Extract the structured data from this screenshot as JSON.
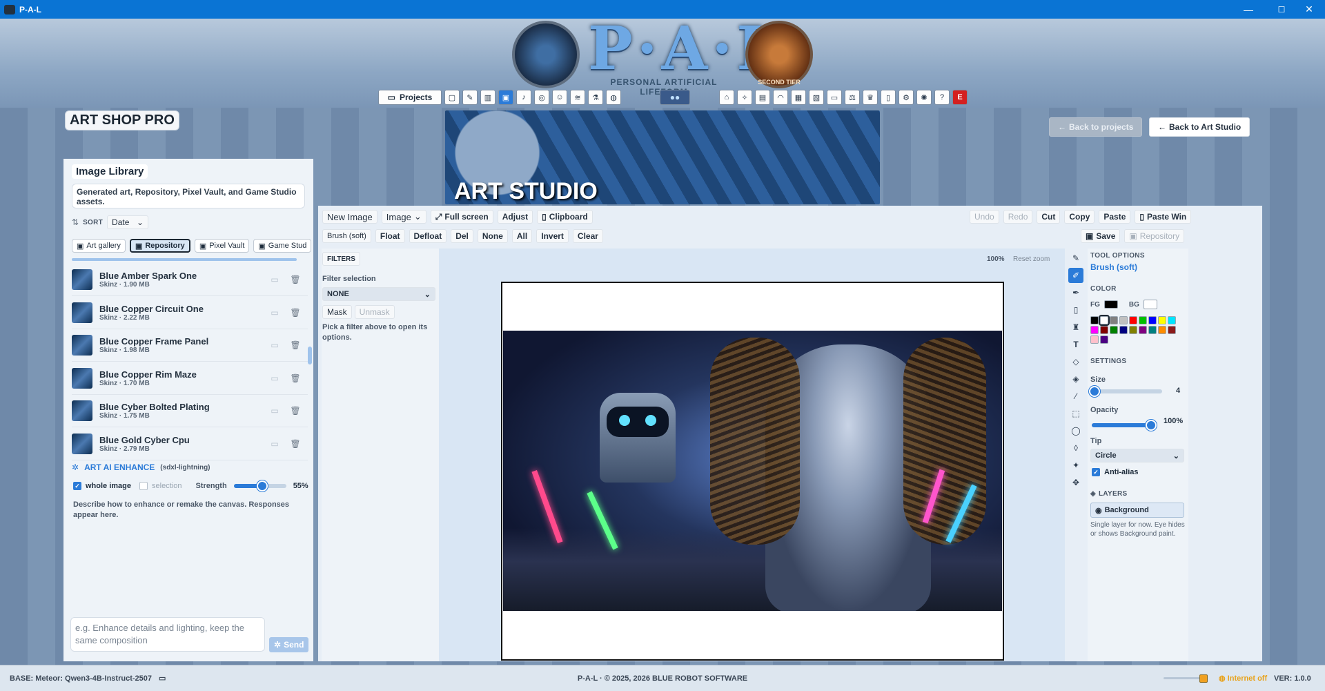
{
  "window": {
    "title": "P-A-L",
    "minimize": "—",
    "maximize": "☐",
    "close": "✕"
  },
  "header": {
    "logo_text": "P·A·L",
    "logo_subtitle": "PERSONAL ARTIFICIAL LIFEFORM",
    "badge_text": "SECOND TIER",
    "projects_label": "Projects",
    "nav_last": "E"
  },
  "app": {
    "title": "ART SHOP PRO",
    "banner": "ART STUDIO",
    "back_projects": "Back to projects",
    "back_art_studio": "Back to Art Studio"
  },
  "library": {
    "title": "Image Library",
    "description": "Generated art, Repository, Pixel Vault, and Game Studio assets.",
    "sort_label": "SORT",
    "sort_value": "Date",
    "tabs": [
      "Art gallery",
      "Repository",
      "Pixel Vault",
      "Game Stud"
    ],
    "items": [
      {
        "title": "Blue Amber Spark One",
        "sub": "Skinz · 1.90 MB"
      },
      {
        "title": "Blue Copper Circuit One",
        "sub": "Skinz · 2.22 MB"
      },
      {
        "title": "Blue Copper Frame Panel",
        "sub": "Skinz · 1.98 MB"
      },
      {
        "title": "Blue Copper Rim Maze",
        "sub": "Skinz · 1.70 MB"
      },
      {
        "title": "Blue Cyber Bolted Plating",
        "sub": "Skinz · 1.75 MB"
      },
      {
        "title": "Blue Gold Cyber Cpu",
        "sub": "Skinz · 2.79 MB"
      }
    ]
  },
  "enhance": {
    "title": "ART AI ENHANCE",
    "model": "(sdxl-lightning)",
    "whole_image": "whole image",
    "selection": "selection",
    "strength_label": "Strength",
    "strength_value": "55%",
    "strength": 0.55,
    "hint": "Describe how to enhance or remake the canvas. Responses appear here.",
    "placeholder": "e.g. Enhance details and lighting, keep the same composition",
    "send": "Send"
  },
  "toolbar": {
    "row1": [
      "New Image",
      "Image",
      "Full screen",
      "Adjust",
      "Clipboard"
    ],
    "row1_right": [
      "Undo",
      "Redo",
      "Cut",
      "Copy",
      "Paste",
      "Paste Win"
    ],
    "row2": [
      "Brush (soft)",
      "Float",
      "Defloat",
      "Del",
      "None",
      "All",
      "Invert",
      "Clear"
    ],
    "row2_right": [
      "Save",
      "Repository"
    ]
  },
  "filters": {
    "title": "FILTERS",
    "label": "Filter selection",
    "value": "NONE",
    "mask": "Mask",
    "unmask": "Unmask",
    "hint": "Pick a filter above to open its options."
  },
  "zoom": {
    "level": "100%",
    "reset": "Reset zoom"
  },
  "tool_options": {
    "title": "TOOL OPTIONS",
    "tool": "Brush (soft)",
    "color_title": "COLOR",
    "fg": "FG",
    "bg": "BG",
    "fg_color": "#000000",
    "bg_color": "#ffffff",
    "palette": [
      "#000000",
      "#ffffff",
      "#808080",
      "#c0c0c0",
      "#ff0000",
      "#00c000",
      "#0000ff",
      "#ffff00",
      "#00e5ff",
      "#ff00ff",
      "#800000",
      "#008000",
      "#000080",
      "#808000",
      "#800080",
      "#008080",
      "#ff8c00",
      "#8b1a1a",
      "#ffc0cb",
      "#4b0082"
    ],
    "settings_title": "SETTINGS",
    "size_label": "Size",
    "size_value": "4",
    "size": 0.04,
    "opacity_label": "Opacity",
    "opacity_value": "100%",
    "opacity": 1.0,
    "tip_label": "Tip",
    "tip_value": "Circle",
    "antialias": "Anti-alias",
    "layers_title": "LAYERS",
    "layer": "Background",
    "layers_hint": "Single layer for now. Eye hides or shows Background paint."
  },
  "footer": {
    "base": "BASE: Meteor: Qwen3-4B-Instruct-2507",
    "copyright": "P-A-L · © 2025, 2026 BLUE ROBOT SOFTWARE",
    "internet": "Internet off",
    "version": "VER: 1.0.0"
  },
  "colors": {
    "accent": "#2b7bd8",
    "titlebar": "#0a74d4",
    "danger": "#d42020"
  }
}
